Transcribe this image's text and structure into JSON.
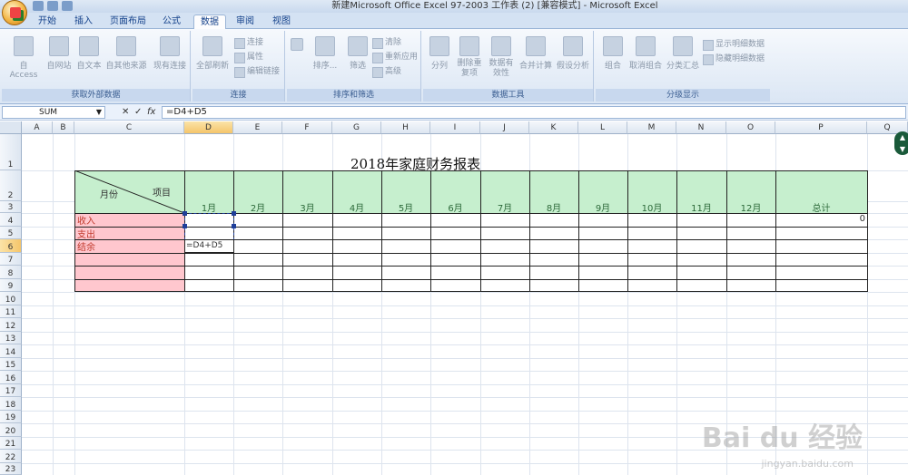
{
  "window": {
    "title": "新建Microsoft Office Excel 97-2003 工作表 (2)  [兼容模式] - Microsoft Excel"
  },
  "tabs": [
    {
      "label": "开始"
    },
    {
      "label": "插入"
    },
    {
      "label": "页面布局"
    },
    {
      "label": "公式"
    },
    {
      "label": "数据"
    },
    {
      "label": "审阅"
    },
    {
      "label": "视图"
    }
  ],
  "ribbon": {
    "get_external": {
      "label": "获取外部数据",
      "buttons": [
        "自 Access",
        "自网站",
        "自文本",
        "自其他来源",
        "现有连接"
      ]
    },
    "connections": {
      "label": "连接",
      "refresh": "全部刷新",
      "small": [
        "连接",
        "属性",
        "编辑链接"
      ]
    },
    "sort_filter": {
      "label": "排序和筛选",
      "sort": "排序...",
      "filter": "筛选",
      "small": [
        "清除",
        "重新应用",
        "高级"
      ]
    },
    "data_tools": {
      "label": "数据工具",
      "buttons": [
        "分列",
        "删除重复项",
        "数据有效性",
        "合并计算",
        "假设分析"
      ]
    },
    "outline": {
      "label": "分级显示",
      "buttons": [
        "组合",
        "取消组合",
        "分类汇总"
      ],
      "small": [
        "显示明细数据",
        "隐藏明细数据"
      ]
    }
  },
  "formula_bar": {
    "name_box": "SUM",
    "formula": "=D4+D5",
    "cancel_glyph": "✕",
    "enter_glyph": "✓",
    "fx_glyph": "fx"
  },
  "sheet": {
    "columns": [
      "A",
      "B",
      "C",
      "D",
      "E",
      "F",
      "G",
      "H",
      "I",
      "J",
      "K",
      "L",
      "M",
      "N",
      "O",
      "P",
      "Q"
    ],
    "rows": [
      "1",
      "2",
      "3",
      "4",
      "5",
      "6",
      "7",
      "8",
      "9",
      "10",
      "11",
      "12",
      "13",
      "14",
      "15",
      "16",
      "17",
      "18",
      "19",
      "20",
      "21",
      "22",
      "23"
    ],
    "title": "2018年家庭财务报表",
    "header_item": "项目",
    "header_month": "月份",
    "months": [
      "1月",
      "2月",
      "3月",
      "4月",
      "5月",
      "6月",
      "7月",
      "8月",
      "9月",
      "10月",
      "11月",
      "12月"
    ],
    "total_label": "总计",
    "row_labels": [
      "收入",
      "支出",
      "结余"
    ],
    "p4_value": "0",
    "edit_cell": "=D4+D5",
    "active_cell_ref": "D6"
  },
  "watermark": {
    "brand": "Bai du 经验",
    "url": "jingyan.baidu.com"
  },
  "colors": {
    "header_green": "#c6efce",
    "label_pink": "#ffc7ce",
    "ribbon_blue": "#dbe6f4"
  }
}
